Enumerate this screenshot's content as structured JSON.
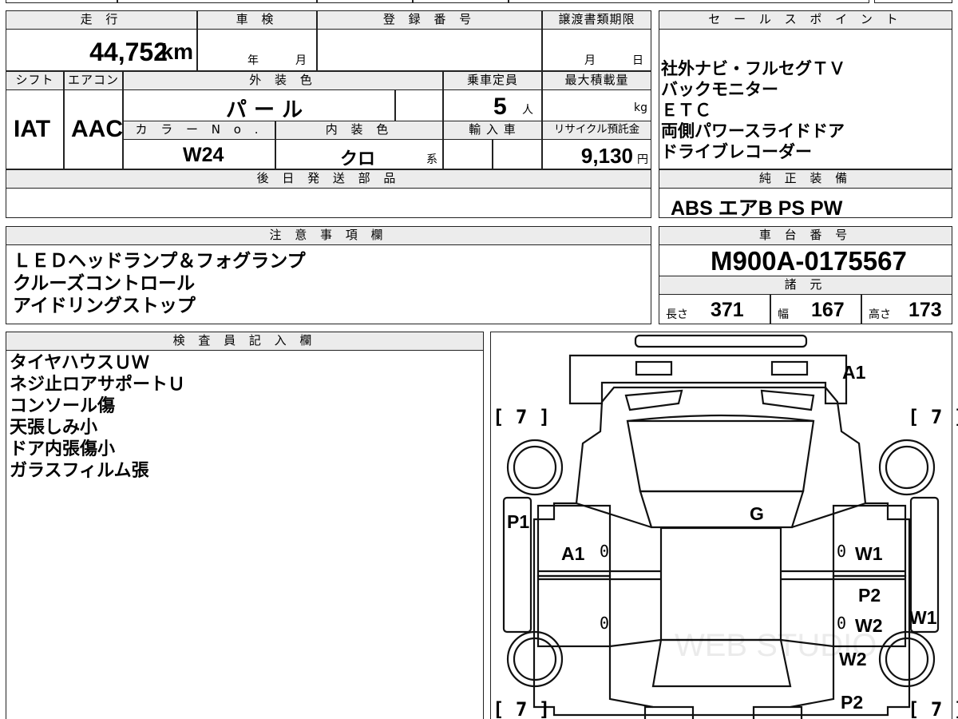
{
  "headers": {
    "mileage": "走 行",
    "inspection": "車 検",
    "registration": "登 録 番 号",
    "transfer_deadline": "譲渡書類期限",
    "sales_points": "セ ー ル ス ポ イ ン ト",
    "shift": "シフト",
    "aircon": "エアコン",
    "exterior_color": "外 装 色",
    "capacity": "乗車定員",
    "max_load": "最大積載量",
    "color_no": "カ ラ ー N o .",
    "interior_color": "内 装 色",
    "import": "輸 入 車",
    "recycle": "リサイクル預託金",
    "later_parts": "後 日 発 送 部 品",
    "standard_equipment": "純 正 装 備",
    "notes": "注 意 事 項 欄",
    "chassis_no": "車 台 番 号",
    "specs": "諸 元",
    "inspector": "検 査 員 記 入 欄"
  },
  "vehicle": {
    "mileage_value": "44,752",
    "mileage_unit": "km",
    "inspection_year": "年",
    "inspection_month": "月",
    "transfer_month": "月",
    "transfer_day": "日",
    "shift": "IAT",
    "aircon": "AAC",
    "exterior_color": "パ ー ル",
    "capacity_value": "5",
    "capacity_unit": "人",
    "max_load_unit": "kg",
    "color_no": "W24",
    "interior_color": "クロ",
    "interior_suffix": "系",
    "recycle_value": "9,130",
    "recycle_unit": "円",
    "chassis_no": "M900A-0175567",
    "length_label": "長さ",
    "length_value": "371",
    "width_label": "幅",
    "width_value": "167",
    "height_label": "高さ",
    "height_value": "173"
  },
  "sales_points": [
    "社外ナビ・フルセグＴＶ",
    "バックモニター",
    "ＥＴＣ",
    "両側パワースライドドア",
    "ドライブレコーダー"
  ],
  "standard_equipment": "ABS エアB PS PW",
  "notes": [
    "ＬＥＤヘッドランプ＆フォグランプ",
    "クルーズコントロール",
    "アイドリングストップ"
  ],
  "inspector_notes": [
    "タイヤハウスＵＷ",
    "ネジ止ロアサポートＵ",
    "コンソール傷",
    "天張しみ小",
    "ドア内張傷小",
    "ガラスフィルム張"
  ],
  "diagram": {
    "tire_left_top": "7",
    "tire_right_top": "7",
    "tire_left_bottom": "7",
    "tire_right_bottom": "7",
    "front": "A1",
    "glass": "G",
    "left_fender": "P1",
    "left_front_door": "A1",
    "left_front_door_zero": "0",
    "left_rear_door_zero": "0",
    "right_front_door_zero": "0",
    "right_front_door": "W1",
    "right_rear_door_top": "P2",
    "right_rear_door_zero": "0",
    "right_rear_door": "W2",
    "right_side": "W1",
    "right_rear_quarter": "W2",
    "right_rear_bottom": "P2"
  },
  "watermark": "WEB STUDIO"
}
